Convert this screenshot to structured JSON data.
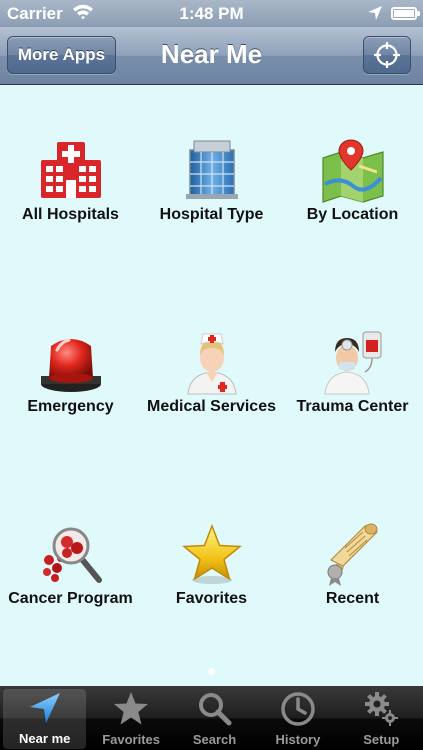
{
  "status_bar": {
    "carrier": "Carrier",
    "time": "1:48 PM"
  },
  "nav": {
    "title": "Near Me",
    "left_button": "More Apps",
    "right_button_icon": "crosshair-icon"
  },
  "grid": [
    {
      "label": "All Hospitals",
      "icon": "hospital-building-icon"
    },
    {
      "label": "Hospital Type",
      "icon": "hospital-tower-icon"
    },
    {
      "label": "By Location",
      "icon": "map-pin-icon"
    },
    {
      "label": "Emergency",
      "icon": "siren-icon"
    },
    {
      "label": "Medical Services",
      "icon": "nurse-icon"
    },
    {
      "label": "Trauma Center",
      "icon": "doctor-icon"
    },
    {
      "label": "Cancer Program",
      "icon": "magnifier-cells-icon"
    },
    {
      "label": "Favorites",
      "icon": "star-icon"
    },
    {
      "label": "Recent",
      "icon": "scroll-icon"
    }
  ],
  "tabs": [
    {
      "label": "Near me",
      "icon": "location-arrow-icon",
      "active": true
    },
    {
      "label": "Favorites",
      "icon": "star-icon"
    },
    {
      "label": "Search",
      "icon": "search-icon"
    },
    {
      "label": "History",
      "icon": "clock-icon"
    },
    {
      "label": "Setup",
      "icon": "gear-icon"
    }
  ],
  "colors": {
    "background": "#e0fafc",
    "nav_blue": "#6d84a2",
    "tab_bar": "#000000",
    "hospital_red": "#d8262b"
  }
}
